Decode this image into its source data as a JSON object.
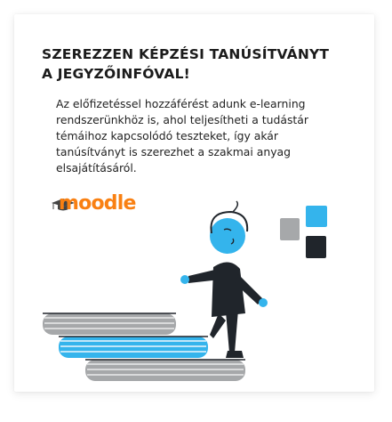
{
  "card": {
    "title": "SZEREZZEN KÉPZÉSI TANÚSÍTVÁNYT A JEGYZŐINFÓVAL!",
    "description": "Az előfizetéssel hozzáférést adunk e-learning rendszerünkhöz is, ahol teljesítheti a tudástár témáihoz kapcsolódó teszteket, így akár tanúsítványt is szerezhet a szakmai anyag elsajátításáról.",
    "logo_text": "moodle"
  },
  "colors": {
    "accent_blue": "#34b4ec",
    "moodle_orange": "#f98012",
    "dark": "#20252b",
    "grey": "#a6a8aa"
  }
}
